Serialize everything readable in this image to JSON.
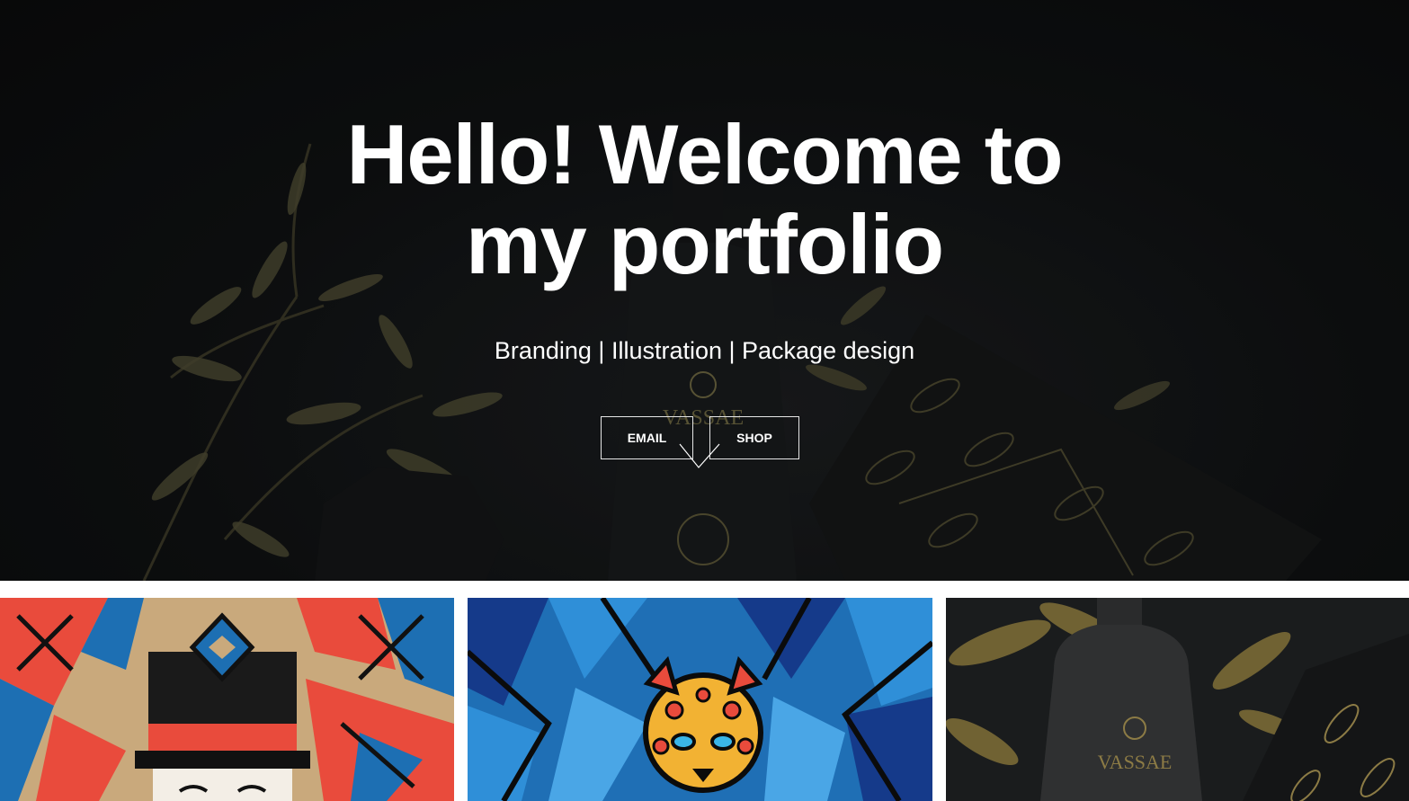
{
  "hero": {
    "title_line1": "Hello! Welcome to",
    "title_line2": "my portfolio",
    "subtitle": "Branding | Illustration | Package design",
    "bottle_brand": "VASSAE"
  },
  "cta": {
    "email_label": "EMAIL",
    "shop_label": "SHOP"
  },
  "gallery": {
    "items": [
      {
        "name": "illustration-nutcracker"
      },
      {
        "name": "illustration-leopard"
      },
      {
        "name": "package-vassae",
        "brand": "VASSAE"
      }
    ]
  },
  "colors": {
    "hero_bg": "#0f1112",
    "text": "#ffffff",
    "olive_gold": "#6b6540",
    "accent_blue": "#1f6fb5",
    "accent_red": "#e84a3c",
    "accent_tan": "#c8a878"
  }
}
